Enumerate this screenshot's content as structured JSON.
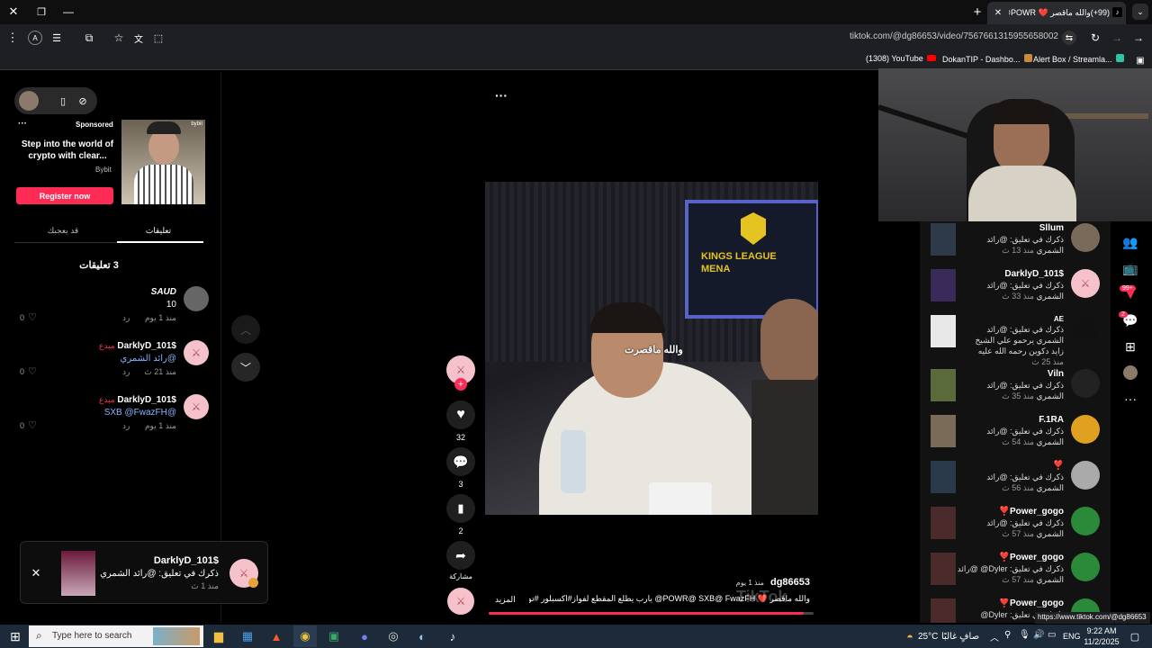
{
  "browser": {
    "tab_title": "(99+)والله ماقصر ❤️ POWR@",
    "address": "tiktok.com/@dg86653/video/7567661315955658002",
    "bookmarks": [
      "(1308) YouTube",
      "DokanTIP - Dashbo...",
      "Alert Box / Streamla..."
    ],
    "status_url": "https://www.tiktok.com/@dg86653"
  },
  "sponsored": {
    "label": "Sponsored",
    "headline": "Step into the world of crypto with clear...",
    "brand": "Bybit",
    "cta": "Register now"
  },
  "comments_panel": {
    "tab_comments": "تعليقات",
    "tab_liked": "قد يعجبك",
    "count": "3 تعليقات",
    "items": [
      {
        "user": "SAUD",
        "badge": "",
        "text": "10",
        "time": "منذ 1 يوم",
        "reply": "رد",
        "likes": "0"
      },
      {
        "user": "DarklyD_101$",
        "badge": "مبدع",
        "text": "رائد الشمري@",
        "time": "منذ 21 ث",
        "reply": "رد",
        "likes": "0"
      },
      {
        "user": "DarklyD_101$",
        "badge": "مبدع",
        "text": "SXB @FwazFH@",
        "time": "منذ 1 يوم",
        "reply": "رد",
        "likes": "0"
      }
    ]
  },
  "toast": {
    "user": "DarklyD_101$",
    "text": "ذكرك في تعليق: @رائد الشمري",
    "time": "منذ 1 ث"
  },
  "video": {
    "overlay_text": "والله ماقصرت",
    "screen_text": "KINGS LEAGUE MENA",
    "author": "dg86653",
    "posted": "منذ 1 يوم",
    "caption": "والله ماقصر ❤️ POWR@ SXB@ FwazFH@ يارب يطلع المقطع لفواز#اكسبلور #تونق ...",
    "more": "المزيد",
    "watermark": "TikTok",
    "progress": 0.97
  },
  "actions": {
    "likes": "32",
    "comments": "3",
    "saves": "2",
    "share": "مشاركة"
  },
  "notifications": {
    "inbox_badge": "99+",
    "msg_badge": "2",
    "items": [
      {
        "user": "Sllum",
        "text": "ذكرك في تعليق: @رائد الشمري",
        "time": "منذ 13 ث"
      },
      {
        "user": "DarklyD_101$",
        "text": "ذكرك في تعليق: @رائد الشمري",
        "time": "منذ 33 ث"
      },
      {
        "user": "AE",
        "text": "ذكرك في تعليق: @رائد الشمري يرحمو علي الشيخ زايد دكوين رحمه الله عليه",
        "time": "منذ 25 ث"
      },
      {
        "user": "Viln",
        "text": "ذكرك في تعليق: @رائد الشمري",
        "time": "منذ 35 ث"
      },
      {
        "user": "F.1RA",
        "text": "ذكرك في تعليق: @رائد الشمري",
        "time": "منذ 54 ث"
      },
      {
        "user": "❣️",
        "text": "ذكرك في تعليق: @رائد الشمري",
        "time": "منذ 56 ث"
      },
      {
        "user": "Power_gogo❣️",
        "text": "ذكرك في تعليق: @رائد الشمري",
        "time": "منذ 57 ث"
      },
      {
        "user": "Power_gogo❣️",
        "text": "ذكرك في تعليق: Dyler@ @رائد الشمري",
        "time": "منذ 57 ث"
      },
      {
        "user": "Power_gogo❣️",
        "text": "ذكرك في تعليق: Dyler@",
        "time": ""
      }
    ]
  },
  "taskbar": {
    "search_placeholder": "Type here to search",
    "temp": "25°C",
    "weather": "صافٍ غالبًا",
    "lang": "ENG",
    "time": "9:22 AM",
    "date": "11/2/2025"
  },
  "colors": {
    "accent": "#fe2c55",
    "pink_avatar": "#f5c2cc",
    "chrome_bar": "#1e1f22",
    "taskbar": "#1c2a3a"
  }
}
